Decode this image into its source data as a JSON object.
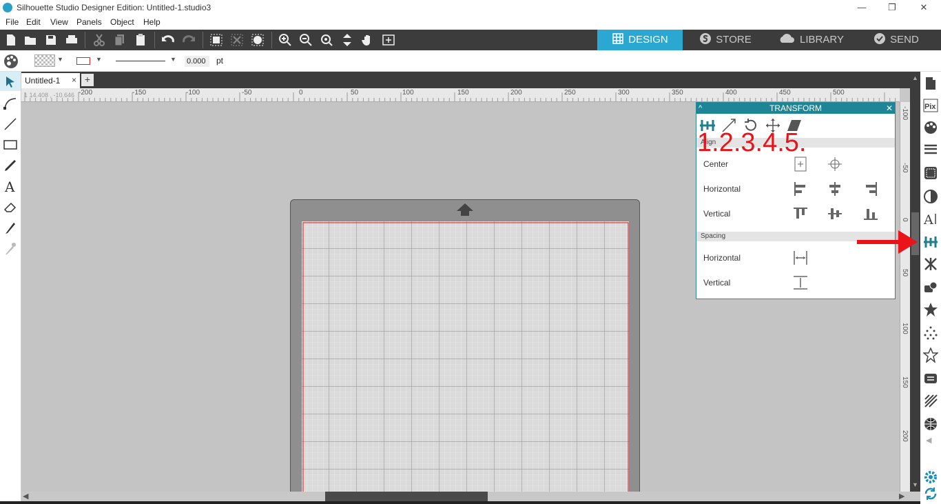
{
  "window": {
    "title": "Silhouette Studio Designer Edition: Untitled-1.studio3",
    "minimize": "—",
    "restore": "❐",
    "close": "✕"
  },
  "menubar": {
    "items": [
      {
        "label": "File"
      },
      {
        "label": "Edit"
      },
      {
        "label": "View"
      },
      {
        "label": "Panels"
      },
      {
        "label": "Object"
      },
      {
        "label": "Help"
      }
    ]
  },
  "nav_tabs": [
    {
      "label": "DESIGN",
      "icon": "grid-icon",
      "active": true
    },
    {
      "label": "STORE",
      "icon": "store-icon",
      "active": false
    },
    {
      "label": "LIBRARY",
      "icon": "cloud-icon",
      "active": false
    },
    {
      "label": "SEND",
      "icon": "check-circle-icon",
      "active": false
    }
  ],
  "propbar": {
    "line_width_value": "0.000",
    "line_width_unit": "pt"
  },
  "doc_tab": {
    "label": "Untitled-1",
    "close": "×",
    "add": "+"
  },
  "coords": "1 14.408 , -10.646",
  "ruler_h": {
    "labels": [
      "-200",
      "-150",
      "-100",
      "-50",
      "0",
      "50",
      "100",
      "150",
      "200",
      "250",
      "300",
      "350",
      "400",
      "450",
      "500"
    ]
  },
  "ruler_v": {
    "labels": [
      "-100",
      "-50",
      "0",
      "50",
      "100",
      "150",
      "200"
    ]
  },
  "transform_panel": {
    "title": "TRANSFORM",
    "collapse": "^",
    "close": "✕",
    "align_section": "Align",
    "spacing_section": "Spacing",
    "rows": {
      "center": "Center",
      "horizontal": "Horizontal",
      "vertical": "Vertical",
      "spacing_horizontal": "Horizontal",
      "spacing_vertical": "Vertical"
    }
  },
  "annotation": {
    "numbers": "1.2.3.4.5.",
    "color": "#e8141a"
  },
  "colors": {
    "accent": "#2aa8d1",
    "panel_header": "#1e8596",
    "toolbar": "#3c3c3c",
    "cut_line": "#e8141a"
  }
}
